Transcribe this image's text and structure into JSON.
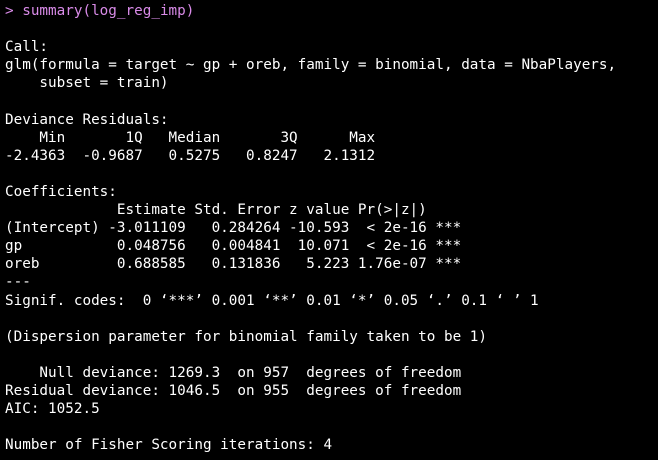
{
  "console": {
    "colors": {
      "background": "#000000",
      "output_text": "#ffffff",
      "command_text": "#d98be8"
    },
    "prompt_symbol": ">",
    "command": "summary(log_reg_imp)",
    "output_lines": [
      "",
      "Call:",
      "glm(formula = target ~ gp + oreb, family = binomial, data = NbaPlayers,",
      "    subset = train)",
      "",
      "Deviance Residuals:",
      "    Min       1Q   Median       3Q      Max",
      "-2.4363  -0.9687   0.5275   0.8247   2.1312",
      "",
      "Coefficients:",
      "             Estimate Std. Error z value Pr(>|z|)",
      "(Intercept) -3.011109   0.284264 -10.593  < 2e-16 ***",
      "gp           0.048756   0.004841  10.071  < 2e-16 ***",
      "oreb         0.688585   0.131836   5.223 1.76e-07 ***",
      "---",
      "Signif. codes:  0 ‘***’ 0.001 ‘**’ 0.01 ‘*’ 0.05 ‘.’ 0.1 ‘ ’ 1",
      "",
      "(Dispersion parameter for binomial family taken to be 1)",
      "",
      "    Null deviance: 1269.3  on 957  degrees of freedom",
      "Residual deviance: 1046.5  on 955  degrees of freedom",
      "AIC: 1052.5",
      "",
      "Number of Fisher Scoring iterations: 4"
    ]
  }
}
